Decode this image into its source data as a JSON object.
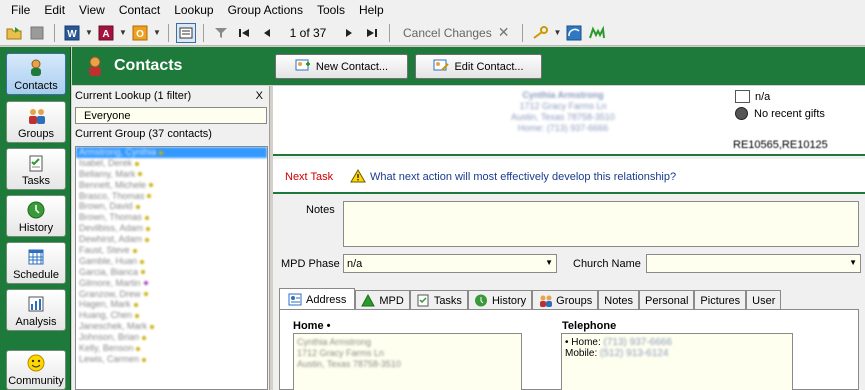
{
  "menu": [
    "File",
    "Edit",
    "View",
    "Contact",
    "Lookup",
    "Group Actions",
    "Tools",
    "Help"
  ],
  "toolbar": {
    "record_counter": "1 of 37",
    "cancel_changes": "Cancel Changes",
    "icons": [
      "open-folder-icon",
      "stop-icon",
      "word-icon",
      "access-icon",
      "outlook-icon",
      "form-view-icon",
      "filter-icon",
      "first-record-icon",
      "previous-record-icon",
      "next-record-icon",
      "last-record-icon",
      "close-icon",
      "key-icon",
      "sync-icon",
      "mpd-icon"
    ]
  },
  "sidebar": {
    "items": [
      {
        "label": "Contacts",
        "icon": "contacts-icon"
      },
      {
        "label": "Groups",
        "icon": "groups-icon"
      },
      {
        "label": "Tasks",
        "icon": "tasks-icon"
      },
      {
        "label": "History",
        "icon": "history-icon"
      },
      {
        "label": "Schedule",
        "icon": "schedule-icon"
      },
      {
        "label": "Analysis",
        "icon": "analysis-icon"
      },
      {
        "label": "Community",
        "icon": "smiley-icon"
      }
    ]
  },
  "header": {
    "title": "Contacts",
    "new_contact": "New Contact...",
    "edit_contact": "Edit Contact..."
  },
  "lookup": {
    "current_lookup": "Current Lookup (1 filter)",
    "close": "X",
    "lookup_value": "Everyone",
    "current_group": "Current Group (37 contacts)",
    "contacts": [
      "Armstrong, Cynthia",
      "Isabel, Derek",
      "Bellamy, Mark",
      "Bennett, Michele",
      "Brasco, Thomas",
      "Brown, David",
      "Brown, Thomas",
      "Devilbiss, Adam",
      "Dewhirst, Adam",
      "Faust, Steve",
      "Gamble, Huan",
      "Garcia, Bianca",
      "Gilmore, Martin",
      "Granzow, Drew",
      "Hagen, Mark",
      "Huang, Chen",
      "Janeschek, Mark",
      "Johnson, Brian",
      "Kelly, Benson",
      "Lewis, Carmen"
    ]
  },
  "card": {
    "name": "Cynthia Armstrong",
    "address_line1": "1712 Gracy Farms Ln",
    "address_line2": "Austin, Texas 78758-3510",
    "phone": "Home: (713) 937-6666",
    "status": "n/a",
    "gifts": "No recent gifts",
    "ids": "RE10565,RE10125"
  },
  "next_task": {
    "label": "Next Task",
    "prompt": "What next action will most effectively develop this relationship?"
  },
  "fields": {
    "notes_label": "Notes",
    "mpd_phase_label": "MPD Phase",
    "mpd_phase_value": "n/a",
    "church_label": "Church Name",
    "church_value": ""
  },
  "tabs": [
    "Address",
    "MPD",
    "Tasks",
    "History",
    "Groups",
    "Notes",
    "Personal",
    "Pictures",
    "User"
  ],
  "address_tab": {
    "home_heading": "Home •",
    "home_lines": [
      "Cynthia Armstrong",
      "1712 Gracy Farms Ln",
      "Austin, Texas 78758-3510"
    ],
    "telephone_heading": "Telephone",
    "phone_home_label": "• Home:",
    "phone_home": "(713) 937-6666",
    "phone_mobile_label": "Mobile:",
    "phone_mobile": "(512) 913-6124"
  },
  "colors": {
    "brand_green": "#1e7a3a",
    "next_task_red": "#cc0000",
    "link_blue": "#1a3c8c",
    "selection": "#3399ff",
    "field_bg": "#fffff0"
  }
}
